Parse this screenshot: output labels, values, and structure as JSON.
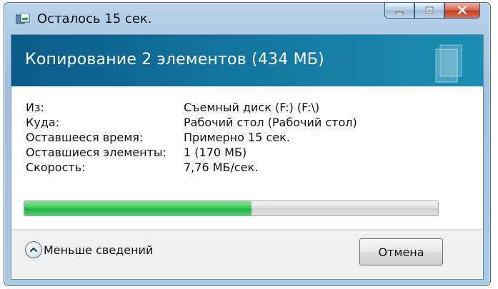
{
  "window": {
    "title": "Осталось 15 сек.",
    "title_icon": "copy-files-icon",
    "caption_buttons": [
      "minimize-icon",
      "maximize-icon",
      "close-icon"
    ]
  },
  "header": {
    "text": "Копирование 2 элементов (434 МБ)",
    "glyph": "document-icon",
    "colors": {
      "from": "#0b5a88",
      "to": "#1a8db3"
    }
  },
  "details": [
    {
      "label": "Из:",
      "value": "Съемный диск (F:) (F:\\)"
    },
    {
      "label": "Куда:",
      "value": "Рабочий стол (Рабочий стол)"
    },
    {
      "label": "Оставшееся время:",
      "value": "Примерно 15 сек."
    },
    {
      "label": "Оставшиеся элементы:",
      "value": "1 (170 МБ)"
    },
    {
      "label": "Скорость:",
      "value": "7,76 МБ/сек."
    }
  ],
  "progress": {
    "fraction": 0.55,
    "color": "#22b043"
  },
  "footer": {
    "toggle_label": "Меньше сведений",
    "toggle_icon": "chevron-up-icon",
    "cancel_label": "Отмена"
  }
}
